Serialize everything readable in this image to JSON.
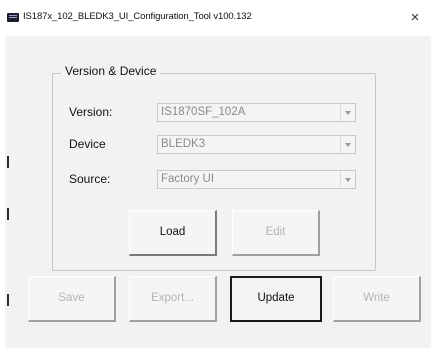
{
  "window": {
    "title": "IS187x_102_BLEDK3_UI_Configuration_Tool v100.132",
    "close_glyph": "×"
  },
  "group": {
    "title": "Version & Device",
    "fields": [
      {
        "label": "Version:",
        "value": "IS1870SF_102A"
      },
      {
        "label": "Device",
        "value": "BLEDK3"
      },
      {
        "label": "Source:",
        "value": "Factory UI"
      }
    ],
    "buttons": {
      "load": "Load",
      "edit": "Edit"
    }
  },
  "actions": {
    "save": "Save",
    "export": "Export...",
    "update": "Update",
    "write": "Write"
  }
}
